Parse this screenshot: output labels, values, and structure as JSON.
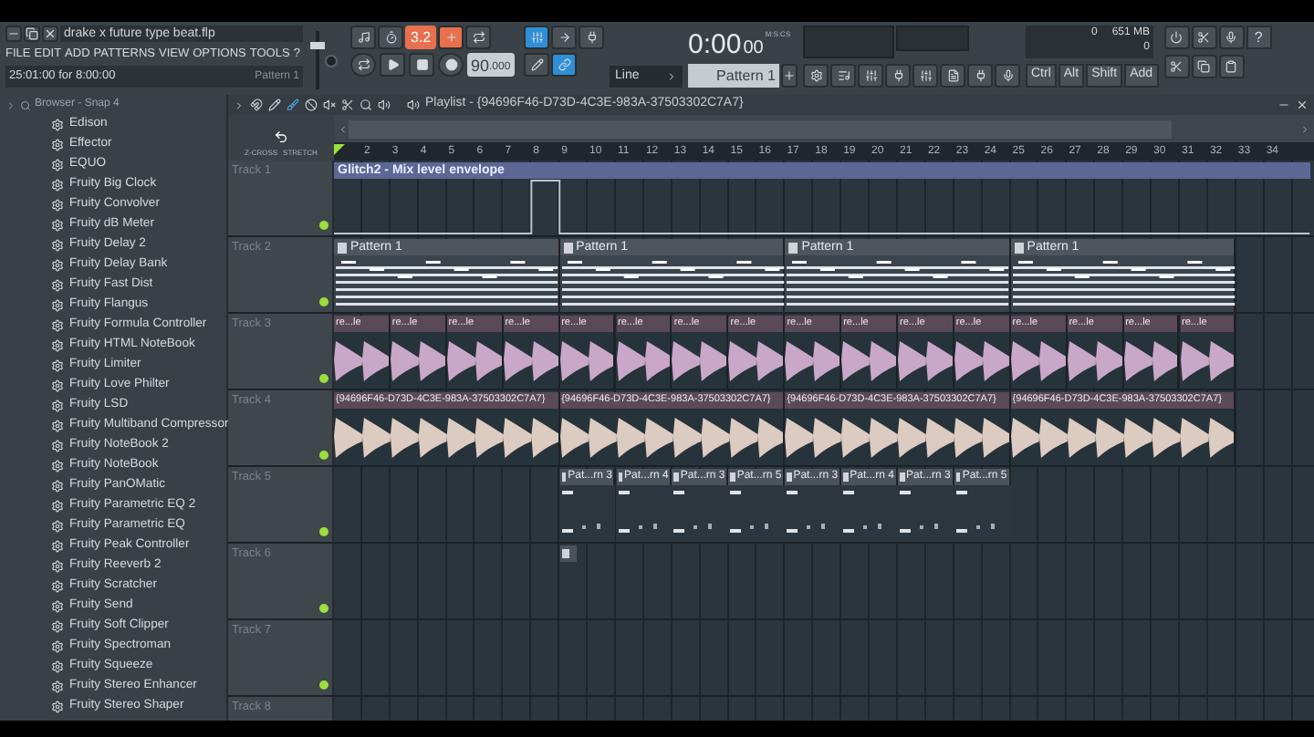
{
  "project": {
    "title": "drake x future type beat.flp",
    "menu": [
      "FILE",
      "EDIT",
      "ADD",
      "PATTERNS",
      "VIEW",
      "OPTIONS",
      "TOOLS",
      "?"
    ],
    "hint": "25:01:00 for 8:00:00",
    "hint_pattern": "Pattern 1"
  },
  "transport": {
    "volume": {
      "level": 0.8
    },
    "snap_value": "3.2",
    "tempo": "90",
    "tempo_fraction": ".000",
    "mode": "Line",
    "time": "0:00",
    "time_cs": "00",
    "time_unit": "M:S:CS",
    "pattern": "Pattern 1",
    "memory": "651 MB",
    "cpu": "0",
    "polyphony": "0",
    "help": "?",
    "keys": [
      "Ctrl",
      "Alt",
      "Shift",
      "Add"
    ]
  },
  "browser": {
    "title": "Browser - Snap 4",
    "items": [
      "Edison",
      "Effector",
      "EQUO",
      "Fruity Big Clock",
      "Fruity Convolver",
      "Fruity dB Meter",
      "Fruity Delay 2",
      "Fruity Delay Bank",
      "Fruity Fast Dist",
      "Fruity Flangus",
      "Fruity Formula Controller",
      "Fruity HTML NoteBook",
      "Fruity Limiter",
      "Fruity Love Philter",
      "Fruity LSD",
      "Fruity Multiband Compressor",
      "Fruity NoteBook 2",
      "Fruity NoteBook",
      "Fruity PanOMatic",
      "Fruity Parametric EQ 2",
      "Fruity Parametric EQ",
      "Fruity Peak Controller",
      "Fruity Reeverb 2",
      "Fruity Scratcher",
      "Fruity Send",
      "Fruity Soft Clipper",
      "Fruity Spectroman",
      "Fruity Squeeze",
      "Fruity Stereo Enhancer",
      "Fruity Stereo Shaper"
    ]
  },
  "playlist": {
    "title": "Playlist - {94696F46-D73D-4C3E-983A-37503302C7A7}",
    "crossfade": "Z-CROSS",
    "stretch": "STRETCH",
    "ruler": [
      "2",
      "3",
      "4",
      "5",
      "6",
      "7",
      "8",
      "9",
      "10",
      "11",
      "12",
      "13",
      "14",
      "15",
      "16",
      "17",
      "18",
      "19",
      "20",
      "21",
      "22",
      "23",
      "24",
      "25",
      "26",
      "27",
      "28",
      "29",
      "30",
      "31",
      "32",
      "33",
      "34"
    ],
    "tracks": [
      {
        "name": "Track 1",
        "enabled": true,
        "clips": [
          {
            "kind": "automation",
            "label": "Glitch2 - Mix level envelope"
          }
        ]
      },
      {
        "name": "Track 2",
        "enabled": true,
        "clips": [
          {
            "kind": "pattern",
            "label": "Pattern 1"
          },
          {
            "kind": "pattern",
            "label": "Pattern 1"
          },
          {
            "kind": "pattern",
            "label": "Pattern 1"
          },
          {
            "kind": "pattern",
            "label": "Pattern 1"
          }
        ]
      },
      {
        "name": "Track 3",
        "enabled": true,
        "clips": [
          {
            "kind": "audio",
            "label": "re...le",
            "color": "#c9a7c8"
          },
          {
            "kind": "audio",
            "label": "re...le",
            "color": "#c9a7c8"
          },
          {
            "kind": "audio",
            "label": "re...le",
            "color": "#c9a7c8"
          },
          {
            "kind": "audio",
            "label": "re...le",
            "color": "#c9a7c8"
          },
          {
            "kind": "audio",
            "label": "re...le",
            "color": "#c9a7c8"
          },
          {
            "kind": "audio",
            "label": "re...le",
            "color": "#c9a7c8"
          },
          {
            "kind": "audio",
            "label": "re...le",
            "color": "#c9a7c8"
          },
          {
            "kind": "audio",
            "label": "re...le",
            "color": "#c9a7c8"
          },
          {
            "kind": "audio",
            "label": "re...le",
            "color": "#c9a7c8"
          },
          {
            "kind": "audio",
            "label": "re...le",
            "color": "#c9a7c8"
          },
          {
            "kind": "audio",
            "label": "re...le",
            "color": "#c9a7c8"
          },
          {
            "kind": "audio",
            "label": "re...le",
            "color": "#c9a7c8"
          },
          {
            "kind": "audio",
            "label": "re...le",
            "color": "#c9a7c8"
          },
          {
            "kind": "audio",
            "label": "re...le",
            "color": "#c9a7c8"
          },
          {
            "kind": "audio",
            "label": "re...le",
            "color": "#c9a7c8"
          },
          {
            "kind": "audio",
            "label": "re...le",
            "color": "#c9a7c8"
          }
        ]
      },
      {
        "name": "Track 4",
        "enabled": true,
        "clips": [
          {
            "kind": "audio",
            "label": "{94696F46-D73D-4C3E-983A-37503302C7A7}",
            "color": "#dccbc0"
          },
          {
            "kind": "audio",
            "label": "{94696F46-D73D-4C3E-983A-37503302C7A7}",
            "color": "#dccbc0"
          },
          {
            "kind": "audio",
            "label": "{94696F46-D73D-4C3E-983A-37503302C7A7}",
            "color": "#dccbc0"
          },
          {
            "kind": "audio",
            "label": "{94696F46-D73D-4C3E-983A-37503302C7A7}",
            "color": "#dccbc0"
          }
        ]
      },
      {
        "name": "Track 5",
        "enabled": true,
        "clips": [
          {
            "kind": "short-pattern",
            "label": "Pat...rn 3"
          },
          {
            "kind": "short-pattern",
            "label": "Pat...rn 4"
          },
          {
            "kind": "short-pattern",
            "label": "Pat...rn 3"
          },
          {
            "kind": "short-pattern",
            "label": "Pat...rn 5"
          },
          {
            "kind": "short-pattern",
            "label": "Pat...rn 3"
          },
          {
            "kind": "short-pattern",
            "label": "Pat...rn 4"
          },
          {
            "kind": "short-pattern",
            "label": "Pat...rn 3"
          },
          {
            "kind": "short-pattern",
            "label": "Pat...rn 5"
          }
        ]
      },
      {
        "name": "Track 6",
        "enabled": true,
        "clips": [
          {
            "kind": "block"
          }
        ]
      },
      {
        "name": "Track 7",
        "enabled": true
      },
      {
        "name": "Track 8"
      }
    ]
  }
}
